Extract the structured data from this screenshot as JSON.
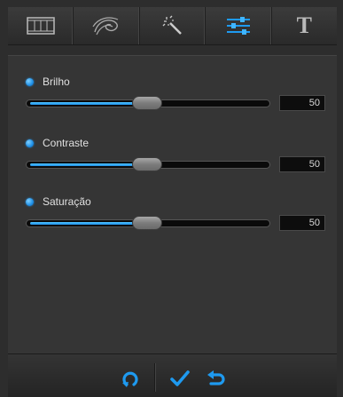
{
  "tabs": [
    {
      "id": "film",
      "icon": "film-strip-icon"
    },
    {
      "id": "effects",
      "icon": "swirl-effects-icon"
    },
    {
      "id": "magic",
      "icon": "magic-wand-icon"
    },
    {
      "id": "adjust",
      "icon": "sliders-icon",
      "active": true
    },
    {
      "id": "text",
      "icon": "text-icon",
      "glyph": "T"
    }
  ],
  "adjustments": [
    {
      "label": "Brilho",
      "value": "50"
    },
    {
      "label": "Contraste",
      "value": "50"
    },
    {
      "label": "Saturação",
      "value": "50"
    }
  ],
  "colors": {
    "accent": "#1e90e8",
    "accent_light": "#4fc3ff"
  },
  "bottombar": {
    "buttons": [
      "rotate-icon",
      "checkmark-icon",
      "undo-icon"
    ]
  }
}
